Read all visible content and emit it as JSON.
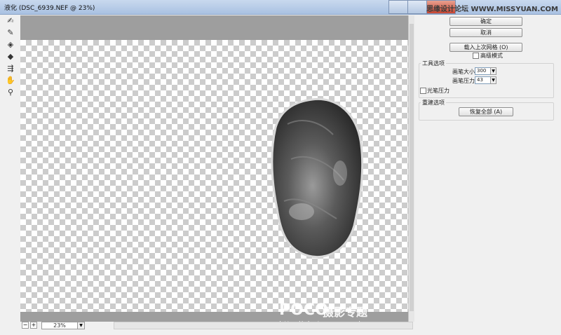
{
  "window": {
    "title": "液化 (DSC_6939.NEF @ 23%)",
    "brand": "思缘设计论坛 WWW.MISSYUAN.COM"
  },
  "toolbar": {
    "tools": [
      "forward-warp-icon",
      "reconstruct-icon",
      "pucker-icon",
      "bloat-icon",
      "push-left-icon",
      "hand-icon",
      "zoom-icon"
    ]
  },
  "panel": {
    "ok_label": "确定",
    "cancel_label": "取消",
    "load_mesh_label": "载入上次网格 (O)",
    "advanced_mode_label": "高级模式",
    "tool_options": {
      "legend": "工具选项",
      "brush_size_label": "画笔大小:",
      "brush_size_value": "300",
      "brush_pressure_label": "画笔压力:",
      "brush_pressure_value": "43",
      "stylus_pressure_label": "光笔压力"
    },
    "reconstruct_options": {
      "legend": "重建选项",
      "restore_all_label": "恢复全部 (A)"
    }
  },
  "status": {
    "zoom_value": "23%",
    "zoom_out": "−",
    "zoom_in": "+"
  },
  "watermark": {
    "logo": "POCO",
    "text": "摄影专题",
    "url": "http://photo.poco.cn/"
  }
}
